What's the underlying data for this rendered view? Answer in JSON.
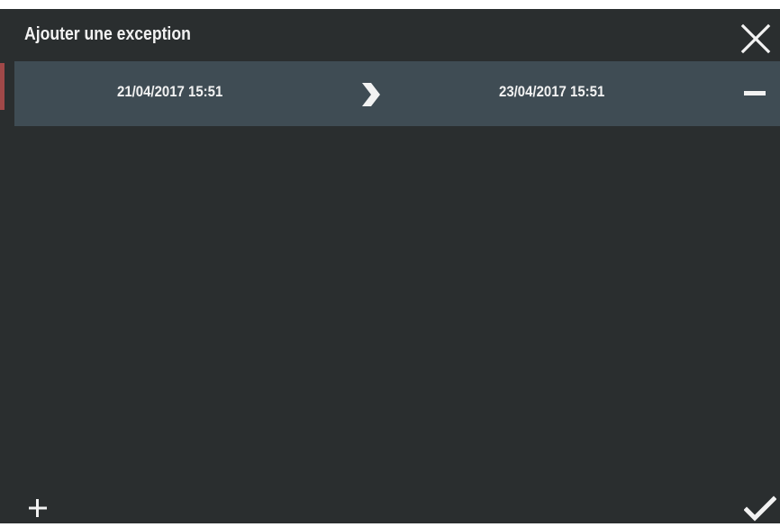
{
  "dialog": {
    "title": "Ajouter une exception",
    "close_icon": "close-icon",
    "add_icon": "plus-icon",
    "confirm_icon": "checkmark-icon"
  },
  "exceptions": [
    {
      "start": "21/04/2017 15:51",
      "end": "23/04/2017 15:51",
      "arrow_icon": "chevron-right-icon",
      "remove_icon": "minus-icon"
    }
  ],
  "colors": {
    "background": "#2a2e2f",
    "row_background": "#3f4c54",
    "text": "#f2f2f2",
    "accent": "#a04848"
  }
}
